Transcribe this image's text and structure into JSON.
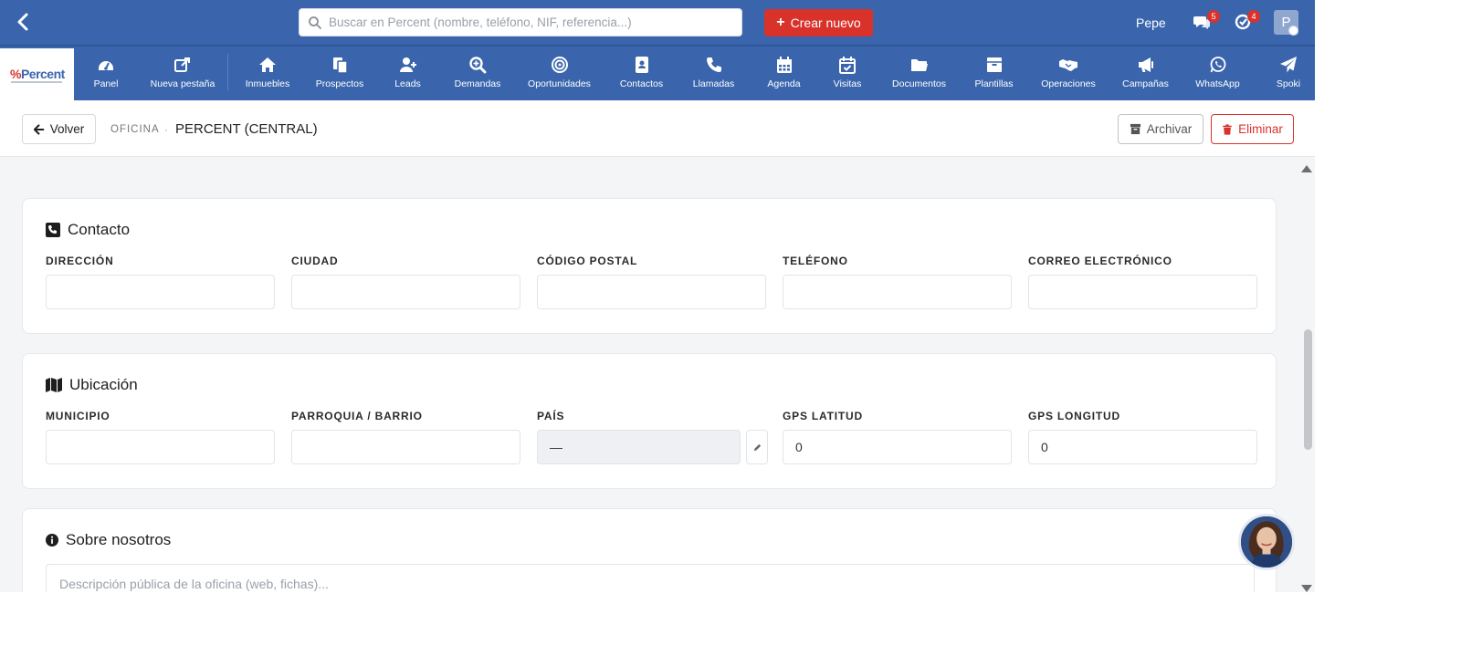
{
  "topbar": {
    "search_placeholder": "Buscar en Percent (nombre, teléfono, NIF, referencia...)",
    "create_label": "Crear nuevo",
    "user_name": "Pepe",
    "chat_badge": "5",
    "tasks_badge": "4",
    "avatar_initial": "P"
  },
  "logo": {
    "letter": "%",
    "name": "Percent"
  },
  "nav": [
    {
      "label": "Panel",
      "icon": "dashboard-icon"
    },
    {
      "label": "Nueva pestaña",
      "icon": "external-link-icon"
    },
    {
      "label": "Inmuebles",
      "icon": "home-icon"
    },
    {
      "label": "Prospectos",
      "icon": "copy-icon"
    },
    {
      "label": "Leads",
      "icon": "user-plus-icon"
    },
    {
      "label": "Demandas",
      "icon": "search-plus-icon"
    },
    {
      "label": "Oportunidades",
      "icon": "target-icon"
    },
    {
      "label": "Contactos",
      "icon": "address-book-icon"
    },
    {
      "label": "Llamadas",
      "icon": "phone-icon"
    },
    {
      "label": "Agenda",
      "icon": "calendar-icon"
    },
    {
      "label": "Visitas",
      "icon": "calendar-check-icon"
    },
    {
      "label": "Documentos",
      "icon": "folder-icon"
    },
    {
      "label": "Plantillas",
      "icon": "archive-icon"
    },
    {
      "label": "Operaciones",
      "icon": "handshake-icon"
    },
    {
      "label": "Campañas",
      "icon": "megaphone-icon"
    },
    {
      "label": "WhatsApp",
      "icon": "whatsapp-icon"
    },
    {
      "label": "Spoki",
      "icon": "send-icon"
    }
  ],
  "subheader": {
    "back_label": "Volver",
    "crumb_section": "OFICINA",
    "crumb_sep": "·",
    "crumb_title": "PERCENT (CENTRAL)",
    "archive_label": "Archivar",
    "delete_label": "Eliminar"
  },
  "contacto": {
    "title": "Contacto",
    "fields": [
      {
        "label": "DIRECCIÓN",
        "value": ""
      },
      {
        "label": "CIUDAD",
        "value": ""
      },
      {
        "label": "CÓDIGO POSTAL",
        "value": ""
      },
      {
        "label": "TELÉFONO",
        "value": ""
      },
      {
        "label": "CORREO ELECTRÓNICO",
        "value": ""
      }
    ]
  },
  "ubicacion": {
    "title": "Ubicación",
    "fields": [
      {
        "label": "MUNICIPIO",
        "value": ""
      },
      {
        "label": "PARROQUIA / BARRIO",
        "value": ""
      },
      {
        "label": "PAÍS",
        "value": "—"
      },
      {
        "label": "GPS LATITUD",
        "value": "0"
      },
      {
        "label": "GPS LONGITUD",
        "value": "0"
      }
    ]
  },
  "sobre": {
    "title": "Sobre nosotros",
    "placeholder": "Descripción pública de la oficina (web, fichas)..."
  },
  "colors": {
    "brand": "#3a65ad",
    "danger": "#d8322b"
  }
}
